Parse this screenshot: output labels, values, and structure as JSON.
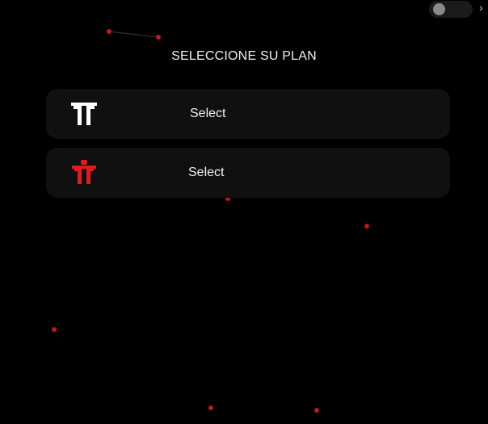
{
  "header": {
    "title": "SELECCIONE SU PLAN"
  },
  "theme_toggle": {
    "state": "off"
  },
  "plans": [
    {
      "label": "Select",
      "icon": "t-logo-white-icon",
      "color": "#ffffff"
    },
    {
      "label": "Select",
      "icon": "t-logo-red-icon",
      "color": "#e21b1b"
    }
  ],
  "colors": {
    "background": "#000000",
    "card": "#101010",
    "accent_red": "#e21b1b",
    "particle": "#c01818"
  }
}
